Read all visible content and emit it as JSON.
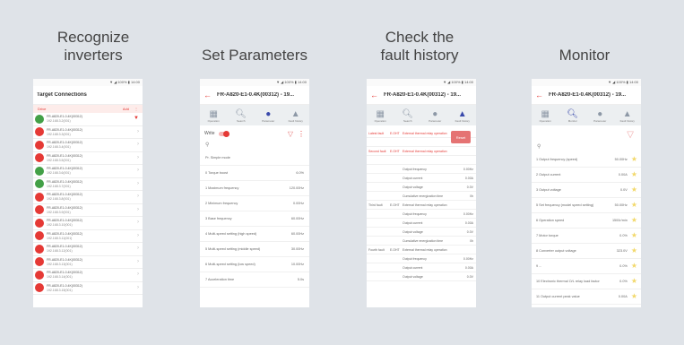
{
  "panels": [
    {
      "caption": "Recognize\ninverters",
      "screen": {
        "status": "▼ ◢ 100% ▮ 14:00",
        "title": "Target Connections",
        "header_left": "Drive",
        "header_right": "Add",
        "inverters": [
          {
            "name": "FR-A820-E1-0.4K(00312)",
            "ip": "192.168.3.2(001)",
            "status": "green"
          },
          {
            "name": "FR-A820-E1-0.4K(00312)",
            "ip": "192.168.3.3(001)",
            "status": "red"
          },
          {
            "name": "FR-A820-E1-0.4K(00312)",
            "ip": "192.168.3.4(001)",
            "status": "red"
          },
          {
            "name": "FR-A820-E1-0.4K(00312)",
            "ip": "192.168.3.5(001)",
            "status": "red"
          },
          {
            "name": "FR-A820-E1-0.4K(00312)",
            "ip": "192.168.3.6(001)",
            "status": "green"
          },
          {
            "name": "FR-A820-E1-0.4K(00312)",
            "ip": "192.168.3.7(001)",
            "status": "green"
          },
          {
            "name": "FR-A820-E1-0.4K(00312)",
            "ip": "192.168.3.8(001)",
            "status": "red"
          },
          {
            "name": "FR-A820-E1-0.4K(00312)",
            "ip": "192.168.3.9(001)",
            "status": "red"
          },
          {
            "name": "FR-A820-E1-0.4K(00312)",
            "ip": "192.168.3.10(001)",
            "status": "red"
          },
          {
            "name": "FR-A820-E1-0.4K(00312)",
            "ip": "192.168.3.11(001)",
            "status": "red"
          },
          {
            "name": "FR-A820-E1-0.4K(00312)",
            "ip": "192.168.3.12(001)",
            "status": "red"
          },
          {
            "name": "FR-A820-E1-0.4K(00312)",
            "ip": "192.168.3.13(001)",
            "status": "red"
          },
          {
            "name": "FR-A820-E1-0.4K(00312)",
            "ip": "192.168.3.14(001)",
            "status": "red"
          },
          {
            "name": "FR-A820-E1-0.4K(00312)",
            "ip": "192.168.3.15(001)",
            "status": "red"
          }
        ]
      }
    },
    {
      "caption": "Set Parameters",
      "screen": {
        "status": "▼ ◢ 100% ▮ 14:00",
        "title": "FR-A820-E1-0.4K(00312) - 19...",
        "tools": [
          "Operation",
          "Search",
          "Parameter",
          "Fault history"
        ],
        "write_label": "Write",
        "search_icon": "search-icon",
        "params": [
          {
            "label": "Pr. Simple mode",
            "value": ""
          },
          {
            "label": "0 Torque boost",
            "value": "6.0%"
          },
          {
            "label": "1 Maximum frequency",
            "value": "120.00Hz"
          },
          {
            "label": "2 Minimum frequency",
            "value": "0.00Hz"
          },
          {
            "label": "3 Base frequency",
            "value": "60.00Hz"
          },
          {
            "label": "4 Multi-speed setting (high speed)",
            "value": "60.00Hz"
          },
          {
            "label": "5 Multi-speed setting (middle speed)",
            "value": "30.00Hz"
          },
          {
            "label": "6 Multi-speed setting (low speed)",
            "value": "10.00Hz"
          },
          {
            "label": "7 Acceleration time",
            "value": "5.0s"
          }
        ]
      }
    },
    {
      "caption": "Check the\nfault history",
      "screen": {
        "status": "▼ ◢ 100% ▮ 14:00",
        "title": "FR-A820-E1-0.4K(00312) - 19...",
        "tools": [
          "Operation",
          "Search",
          "Parameter",
          "Fault history"
        ],
        "reset_label": "Reset",
        "rows": [
          {
            "a": "Latest fault",
            "b": "E.OHT",
            "c": "External thermal relay operation",
            "d": "",
            "red": true
          },
          {
            "a": "",
            "b": "",
            "c": "",
            "d": "",
            "red": true
          },
          {
            "a": "Second fault",
            "b": "E.OHT",
            "c": "External thermal relay operation",
            "d": "",
            "red": true
          },
          {
            "a": "",
            "b": "",
            "c": "",
            "d": "",
            "red": true
          },
          {
            "a": "",
            "b": "",
            "c": "Output frequency",
            "d": "0.00Hz",
            "red": false
          },
          {
            "a": "",
            "b": "",
            "c": "Output current",
            "d": "0.00A",
            "red": false
          },
          {
            "a": "",
            "b": "",
            "c": "Output voltage",
            "d": "0.0V",
            "red": false
          },
          {
            "a": "",
            "b": "",
            "c": "Cumulative energization time",
            "d": "0h",
            "red": false
          },
          {
            "a": "Third fault",
            "b": "E.OHT",
            "c": "External thermal relay operation",
            "d": "",
            "red": false
          },
          {
            "a": "",
            "b": "",
            "c": "Output frequency",
            "d": "0.00Hz",
            "red": false
          },
          {
            "a": "",
            "b": "",
            "c": "Output current",
            "d": "0.00A",
            "red": false
          },
          {
            "a": "",
            "b": "",
            "c": "Output voltage",
            "d": "0.0V",
            "red": false
          },
          {
            "a": "",
            "b": "",
            "c": "Cumulative energization time",
            "d": "0h",
            "red": false
          },
          {
            "a": "Fourth fault",
            "b": "E.OHT",
            "c": "External thermal relay operation",
            "d": "",
            "red": false
          },
          {
            "a": "",
            "b": "",
            "c": "Output frequency",
            "d": "0.00Hz",
            "red": false
          },
          {
            "a": "",
            "b": "",
            "c": "Output current",
            "d": "0.00A",
            "red": false
          },
          {
            "a": "",
            "b": "",
            "c": "Output voltage",
            "d": "0.0V",
            "red": false
          }
        ]
      }
    },
    {
      "caption": "Monitor",
      "screen": {
        "status": "▼ ◢ 100% ▮ 14:00",
        "title": "FR-A820-E1-0.4K(00312) - 19...",
        "tools": [
          "Operation",
          "Monitor",
          "Parameter",
          "Fault history"
        ],
        "filter_icon": "filter-icon",
        "items": [
          {
            "label": "1 Output frequency (speed)",
            "value": "50.00Hz"
          },
          {
            "label": "2 Output current",
            "value": "0.00A"
          },
          {
            "label": "3 Output voltage",
            "value": "0.0V"
          },
          {
            "label": "5 Set frequency (model speed setting)",
            "value": "50.00Hz"
          },
          {
            "label": "6 Operation speed",
            "value": "1500r/min"
          },
          {
            "label": "7 Motor torque",
            "value": "0.0%"
          },
          {
            "label": "8 Converter output voltage",
            "value": "323.0V"
          },
          {
            "label": "9 ...",
            "value": "0.0%"
          },
          {
            "label": "10 Electronic thermal O/L relay load factor",
            "value": "0.0%"
          },
          {
            "label": "11 Output current peak value",
            "value": "0.00A"
          }
        ]
      }
    }
  ],
  "colors": {
    "accent_red": "#e53935",
    "status_green": "#43a047",
    "active_tool": "#3949ab",
    "star": "#f2d86a"
  }
}
